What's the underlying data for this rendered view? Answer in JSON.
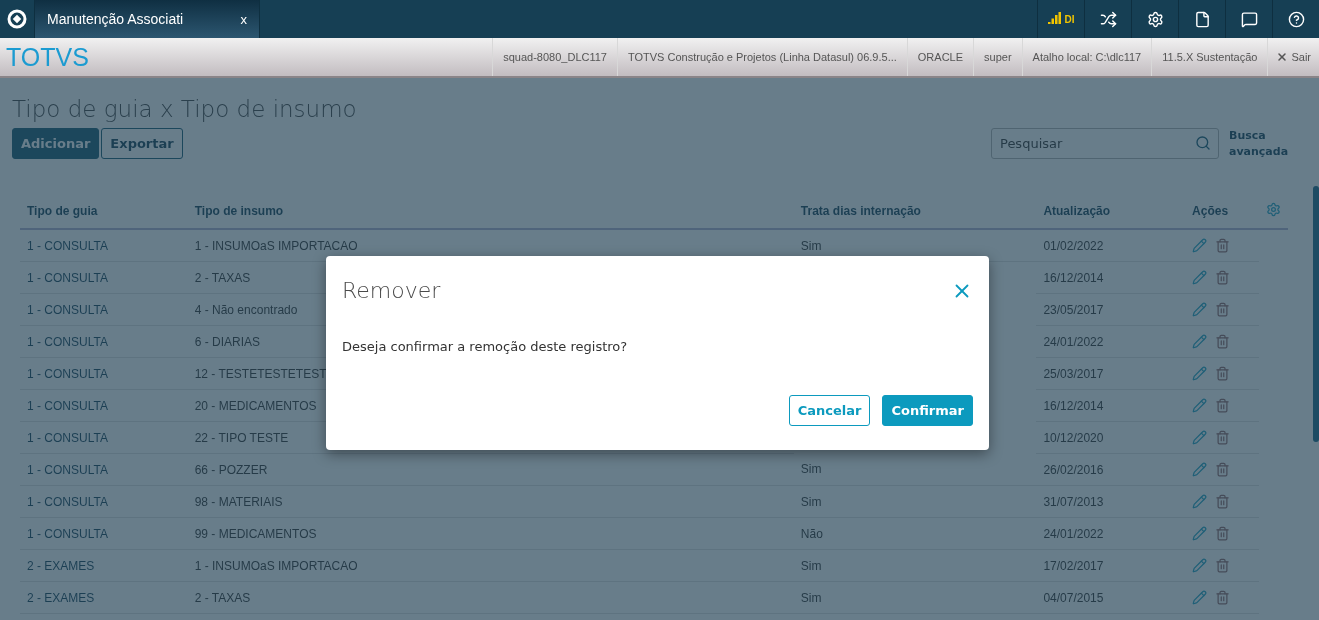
{
  "tabs": [
    {
      "label": "Manutenção Associati",
      "close": "x",
      "selected": true
    }
  ],
  "top_icons": [
    {
      "kind": "signal",
      "label": "DI"
    },
    {
      "kind": "shuffle"
    },
    {
      "kind": "settings"
    },
    {
      "kind": "document"
    },
    {
      "kind": "chat"
    },
    {
      "kind": "help"
    }
  ],
  "header": {
    "logo": "TOTVS",
    "info": [
      "squad-8080_DLC117",
      "TOTVS Construção e Projetos (Linha Datasul) 06.9.5...",
      "ORACLE",
      "super",
      "Atalho local: C:\\dlc117",
      "11.5.X Sustentação"
    ],
    "logout": "Sair"
  },
  "page": {
    "title": "Tipo de guia x Tipo de insumo",
    "buttons": [
      {
        "label": "Adicionar",
        "kind": "primary"
      },
      {
        "label": "Exportar",
        "kind": "secondary"
      }
    ],
    "search": {
      "placeholder": "Pesquisar"
    },
    "advanced_search": "Busca avançada"
  },
  "table": {
    "columns": [
      "Tipo de guia",
      "Tipo de insumo",
      "Trata dias internação",
      "Atualização",
      "Ações"
    ],
    "rows": [
      {
        "guia": "1 - CONSULTA",
        "insumo": "1 - INSUMOaS IMPORTACAO",
        "trata": "Sim",
        "data": "01/02/2022"
      },
      {
        "guia": "1 - CONSULTA",
        "insumo": "2 - TAXAS",
        "data": "16/12/2014"
      },
      {
        "guia": "1 - CONSULTA",
        "insumo": "4 - Não encontrado",
        "data": "23/05/2017"
      },
      {
        "guia": "1 - CONSULTA",
        "insumo": "6 - DIARIAS",
        "data": "24/01/2022"
      },
      {
        "guia": "1 - CONSULTA",
        "insumo": "12 - TESTETESTETEST",
        "data": "25/03/2017"
      },
      {
        "guia": "1 - CONSULTA",
        "insumo": "20 - MEDICAMENTOS",
        "data": "16/12/2014"
      },
      {
        "guia": "1 - CONSULTA",
        "insumo": "22 - TIPO TESTE",
        "data": "10/12/2020"
      },
      {
        "guia": "1 - CONSULTA",
        "insumo": "66 - POZZER",
        "trata": "Sim",
        "data": "26/02/2016"
      },
      {
        "guia": "1 - CONSULTA",
        "insumo": "98 - MATERIAIS",
        "trata": "Sim",
        "data": "31/07/2013"
      },
      {
        "guia": "1 - CONSULTA",
        "insumo": "99 - MEDICAMENTOS",
        "trata": "Não",
        "data": "24/01/2022"
      },
      {
        "guia": "2 - EXAMES",
        "insumo": "1 - INSUMOaS IMPORTACAO",
        "trata": "Sim",
        "data": "17/02/2017"
      },
      {
        "guia": "2 - EXAMES",
        "insumo": "2 - TAXAS",
        "trata": "Sim",
        "data": "04/07/2015"
      }
    ]
  },
  "dialog": {
    "title": "Remover",
    "message": "Deseja confirmar a remoção deste registro?",
    "buttons": [
      {
        "label": "Cancelar",
        "kind": "secondary"
      },
      {
        "label": "Confirmar",
        "kind": "primary"
      }
    ]
  }
}
